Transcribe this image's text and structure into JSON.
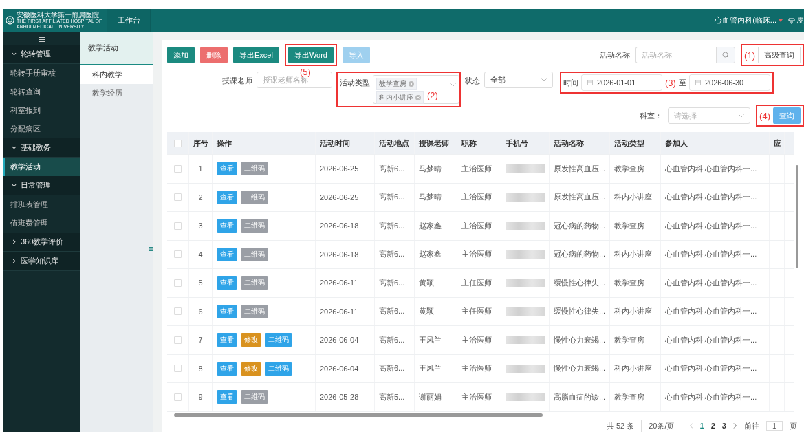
{
  "header": {
    "logo_title": "安徽医科大学第一附属医院",
    "logo_subtitle": "THE FIRST AFFILIATED HOSPITAL OF ANHUI MEDICAL UNIVERSITY",
    "tab": "工作台",
    "user": "心血管内科(临床...",
    "skin": "皮"
  },
  "sidebar": {
    "groups": [
      {
        "label": "轮转管理",
        "expanded": true,
        "children": [
          {
            "label": "轮转手册审核",
            "selected": false
          },
          {
            "label": "轮转查询",
            "selected": false
          },
          {
            "label": "科室报到",
            "selected": false
          },
          {
            "label": "分配病区",
            "selected": false
          }
        ]
      },
      {
        "label": "基础教务",
        "expanded": true,
        "children": [
          {
            "label": "教学活动",
            "selected": true
          }
        ]
      },
      {
        "label": "日常管理",
        "expanded": true,
        "children": [
          {
            "label": "排班表管理",
            "selected": false
          },
          {
            "label": "值班费管理",
            "selected": false
          }
        ]
      },
      {
        "label": "360教学评价",
        "expanded": false
      },
      {
        "label": "医学知识库",
        "expanded": false
      }
    ]
  },
  "subnav": {
    "title": "教学活动",
    "items": [
      {
        "label": "科内教学",
        "selected": true
      },
      {
        "label": "教学经历",
        "selected": false
      }
    ]
  },
  "toolbar": {
    "buttons": [
      {
        "label": "添加",
        "kind": "primary",
        "disabled": false
      },
      {
        "label": "删除",
        "kind": "danger",
        "disabled": false
      },
      {
        "label": "导出Excel",
        "kind": "primary",
        "disabled": false
      },
      {
        "label": "导出Word",
        "kind": "primary",
        "disabled": false,
        "callout": "(5)"
      },
      {
        "label": "导入",
        "kind": "info",
        "disabled": true
      }
    ],
    "search_label": "活动名称",
    "search_placeholder": "活动名称",
    "advanced": {
      "label": "高级查询",
      "callout": "(1)"
    }
  },
  "filters": {
    "teacher_label": "授课老师",
    "teacher_placeholder": "授课老师名称",
    "type_label": "活动类型",
    "type_tags": [
      "教学查房",
      "科内小讲座"
    ],
    "type_callout": "(2)",
    "status_label": "状态",
    "status_value": "全部",
    "time_label": "时间",
    "time_start": "2026-01-01",
    "time_sep": "至",
    "time_end": "2026-06-30",
    "time_callout": "(3)",
    "dept_label": "科室：",
    "dept_placeholder": "请选择",
    "query": {
      "label": "查询",
      "callout": "(4)"
    }
  },
  "table": {
    "select_all_checked": false,
    "columns": [
      "序号",
      "操作",
      "活动时间",
      "活动地点",
      "授课老师",
      "职称",
      "手机号",
      "活动名称",
      "活动类型",
      "参加人",
      "应"
    ],
    "rows": [
      {
        "checked": false,
        "no": "1",
        "actions": [
          {
            "label": "查看",
            "kind": "view",
            "disabled": false
          },
          {
            "label": "二维码",
            "kind": "qrcode",
            "disabled": true
          }
        ],
        "date": "2026-06-25",
        "place": "高新6...",
        "teacher": "马梦晴",
        "title_rank": "主治医师",
        "name": "原发性高血压...",
        "type": "教学查房",
        "participants": "心血管内科,心血管内科一..."
      },
      {
        "checked": false,
        "no": "2",
        "actions": [
          {
            "label": "查看",
            "kind": "view",
            "disabled": false
          },
          {
            "label": "二维码",
            "kind": "qrcode",
            "disabled": true
          }
        ],
        "date": "2026-06-25",
        "place": "高新6...",
        "teacher": "马梦晴",
        "title_rank": "主治医师",
        "name": "原发性高血压...",
        "type": "科内小讲座",
        "participants": "心血管内科,心血管内科一..."
      },
      {
        "checked": false,
        "no": "3",
        "actions": [
          {
            "label": "查看",
            "kind": "view",
            "disabled": false
          },
          {
            "label": "二维码",
            "kind": "qrcode",
            "disabled": true
          }
        ],
        "date": "2026-06-18",
        "place": "高新6...",
        "teacher": "赵家鑫",
        "title_rank": "主治医师",
        "name": "冠心病的药物...",
        "type": "教学查房",
        "participants": "心血管内科,心血管内科一..."
      },
      {
        "checked": false,
        "no": "4",
        "actions": [
          {
            "label": "查看",
            "kind": "view",
            "disabled": false
          },
          {
            "label": "二维码",
            "kind": "qrcode",
            "disabled": true
          }
        ],
        "date": "2026-06-18",
        "place": "高新6...",
        "teacher": "赵家鑫",
        "title_rank": "主治医师",
        "name": "冠心病的药物...",
        "type": "科内小讲座",
        "participants": "心血管内科,心血管内科一..."
      },
      {
        "checked": false,
        "no": "5",
        "actions": [
          {
            "label": "查看",
            "kind": "view",
            "disabled": false
          },
          {
            "label": "二维码",
            "kind": "qrcode",
            "disabled": true
          }
        ],
        "date": "2026-06-11",
        "place": "高新6...",
        "teacher": "黄颖",
        "title_rank": "主任医师",
        "name": "缓慢性心律失...",
        "type": "教学查房",
        "participants": "心血管内科,心血管内科一..."
      },
      {
        "checked": false,
        "no": "6",
        "actions": [
          {
            "label": "查看",
            "kind": "view",
            "disabled": false
          },
          {
            "label": "二维码",
            "kind": "qrcode",
            "disabled": true
          }
        ],
        "date": "2026-06-11",
        "place": "高新6...",
        "teacher": "黄颖",
        "title_rank": "主任医师",
        "name": "缓慢性心律失...",
        "type": "科内小讲座",
        "participants": "心血管内科,心血管内科一..."
      },
      {
        "checked": false,
        "no": "7",
        "actions": [
          {
            "label": "查看",
            "kind": "view",
            "disabled": false
          },
          {
            "label": "修改",
            "kind": "edit",
            "disabled": false
          },
          {
            "label": "二维码",
            "kind": "qrcode",
            "disabled": false
          }
        ],
        "date": "2026-06-04",
        "place": "高新6...",
        "teacher": "王凤兰",
        "title_rank": "主治医师",
        "name": "慢性心力衰竭...",
        "type": "教学查房",
        "participants": "心血管内科,心血管内科一..."
      },
      {
        "checked": false,
        "no": "8",
        "actions": [
          {
            "label": "查看",
            "kind": "view",
            "disabled": false
          },
          {
            "label": "修改",
            "kind": "edit",
            "disabled": false
          },
          {
            "label": "二维码",
            "kind": "qrcode",
            "disabled": false
          }
        ],
        "date": "2026-06-04",
        "place": "高新6...",
        "teacher": "王凤兰",
        "title_rank": "主治医师",
        "name": "慢性心力衰竭...",
        "type": "科内小讲座",
        "participants": "心血管内科,心血管内科一..."
      },
      {
        "checked": false,
        "no": "9",
        "actions": [
          {
            "label": "查看",
            "kind": "view",
            "disabled": false
          },
          {
            "label": "二维码",
            "kind": "qrcode",
            "disabled": true
          }
        ],
        "date": "2026-05-28",
        "place": "高新5...",
        "teacher": "谢丽娟",
        "title_rank": "主治医师",
        "name": "高脂血症的诊...",
        "type": "教学查房",
        "participants": "心血管内科,心血管内科一..."
      }
    ]
  },
  "pagination": {
    "total": "共 52 条",
    "page_size": "20条/页",
    "pages": [
      {
        "label": "1",
        "selected": true
      },
      {
        "label": "2",
        "selected": false
      },
      {
        "label": "3",
        "selected": false
      }
    ],
    "goto_label": "前往",
    "goto_value": "1",
    "goto_suffix": "页"
  }
}
